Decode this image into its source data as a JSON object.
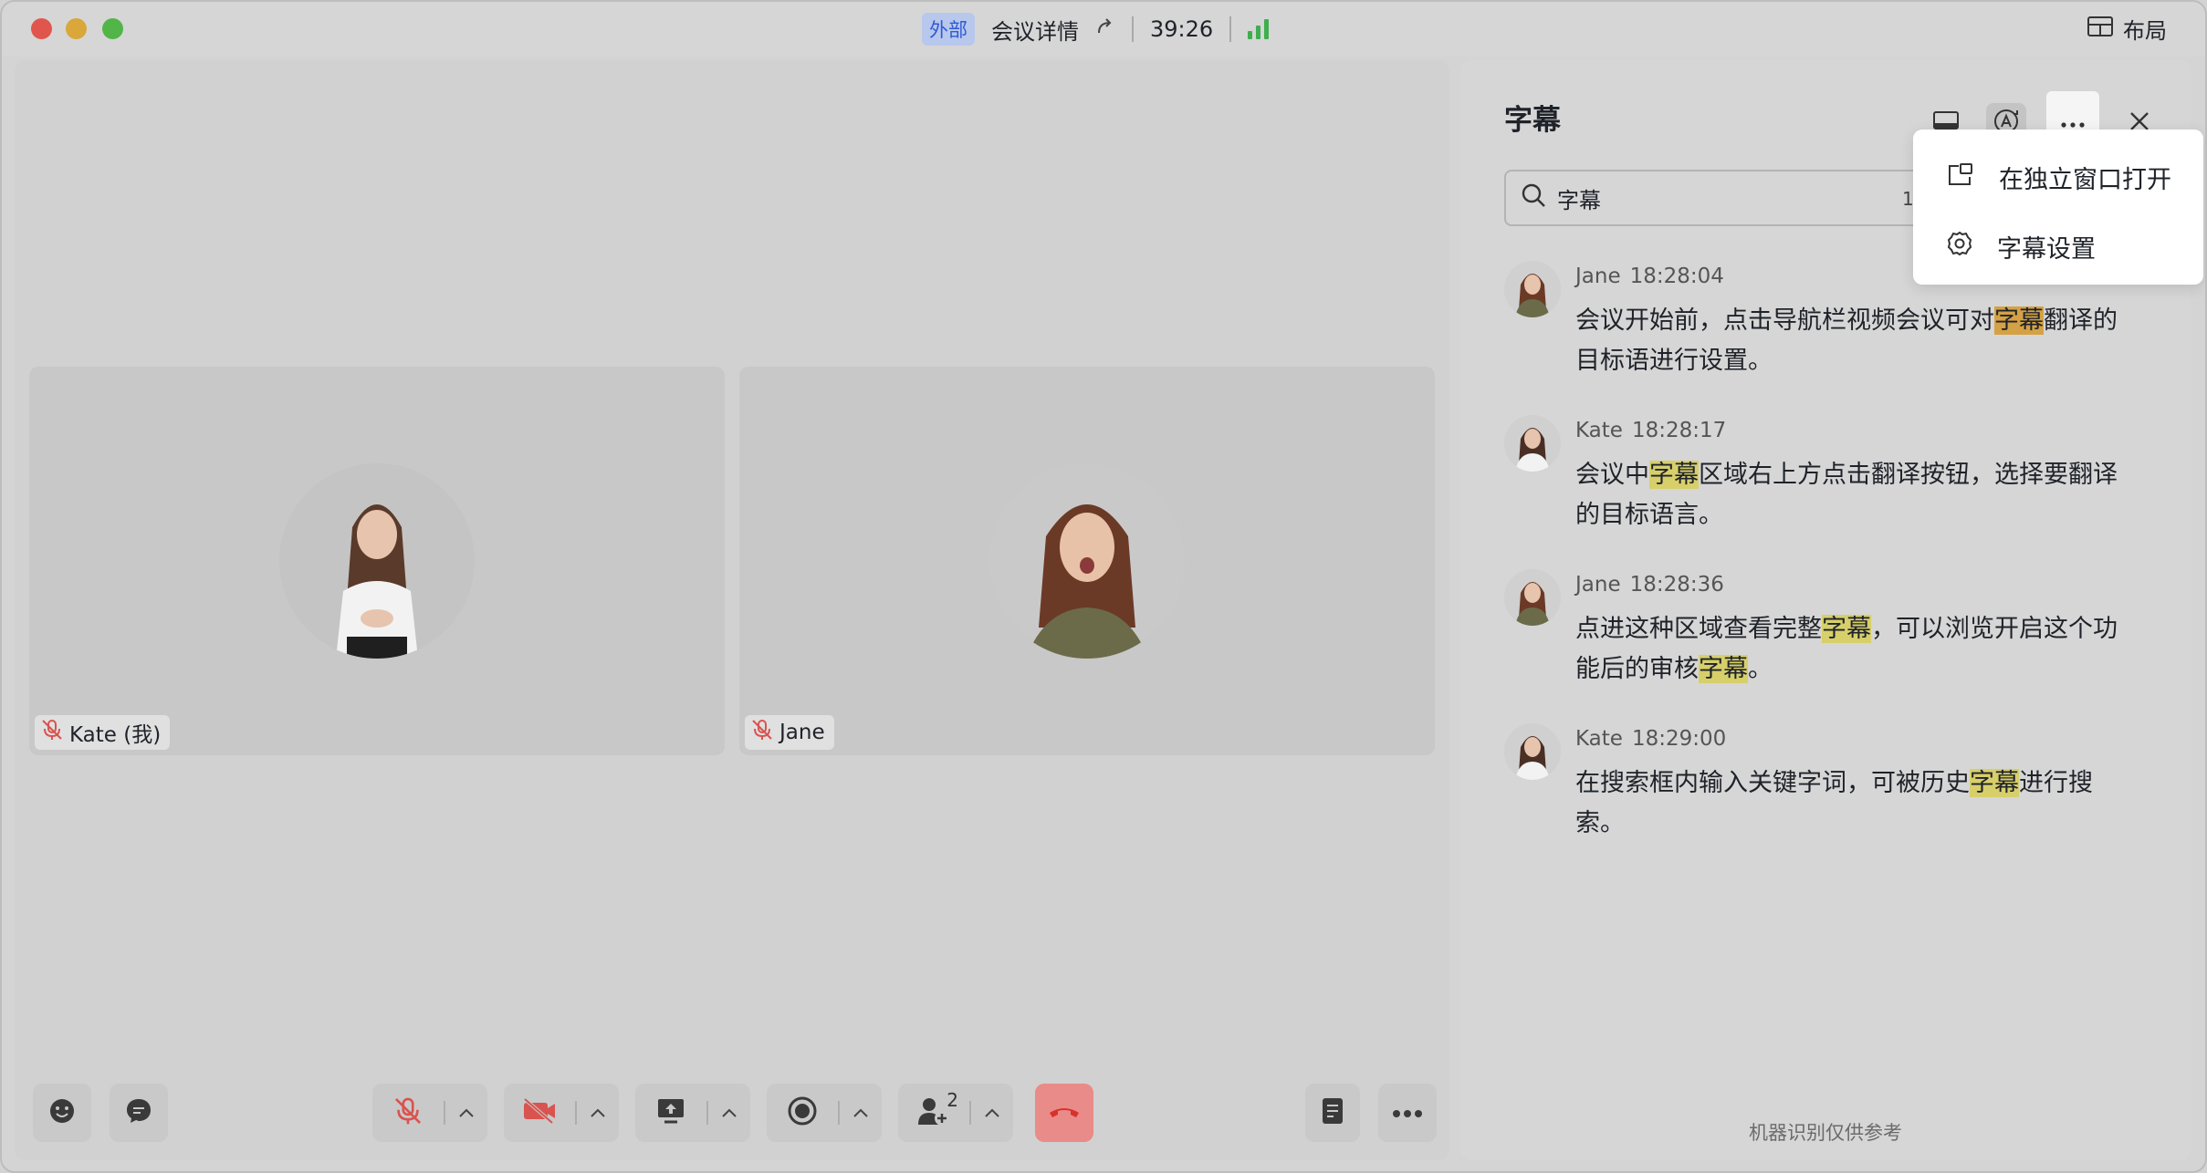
{
  "titlebar": {
    "badge": "外部",
    "meeting_details": "会议详情",
    "timer": "39:26",
    "layout_label": "布局"
  },
  "participants": [
    {
      "name": "Kate (我)",
      "muted": true
    },
    {
      "name": "Jane",
      "muted": true
    }
  ],
  "toolbar": {
    "participant_count": "2"
  },
  "panel": {
    "title": "字幕",
    "search_value": "字幕",
    "search_count": "1/",
    "footer": "机器识别仅供参考",
    "captions": [
      {
        "speaker": "Jane",
        "time": "18:28:04",
        "segments": [
          {
            "t": "会议开始前，点击导航栏视频会议可对",
            "h": ""
          },
          {
            "t": "字幕",
            "h": "strong"
          },
          {
            "t": "翻译的目标语进行设置。",
            "h": ""
          }
        ]
      },
      {
        "speaker": "Kate",
        "time": "18:28:17",
        "segments": [
          {
            "t": "会议中",
            "h": ""
          },
          {
            "t": "字幕",
            "h": "soft"
          },
          {
            "t": "区域右上方点击翻译按钮，选择要翻译的目标语言。",
            "h": ""
          }
        ]
      },
      {
        "speaker": "Jane",
        "time": "18:28:36",
        "segments": [
          {
            "t": "点进这种区域查看完整",
            "h": ""
          },
          {
            "t": "字幕",
            "h": "soft"
          },
          {
            "t": "，可以浏览开启这个功能后的审核",
            "h": ""
          },
          {
            "t": "字幕",
            "h": "soft"
          },
          {
            "t": "。",
            "h": ""
          }
        ]
      },
      {
        "speaker": "Kate",
        "time": "18:29:00",
        "segments": [
          {
            "t": "在搜索框内输入关键字词，可被历史",
            "h": ""
          },
          {
            "t": "字幕",
            "h": "soft"
          },
          {
            "t": "进行搜索。",
            "h": ""
          }
        ]
      }
    ]
  },
  "menu": {
    "open_in_window": "在独立窗口打开",
    "caption_settings": "字幕设置"
  },
  "colors": {
    "accent_blue": "#2f5ad6",
    "signal_green": "#3fae4f",
    "hangup_red": "#e98b88",
    "highlight_soft": "#d7cf6a",
    "highlight_strong": "#d4a144"
  }
}
